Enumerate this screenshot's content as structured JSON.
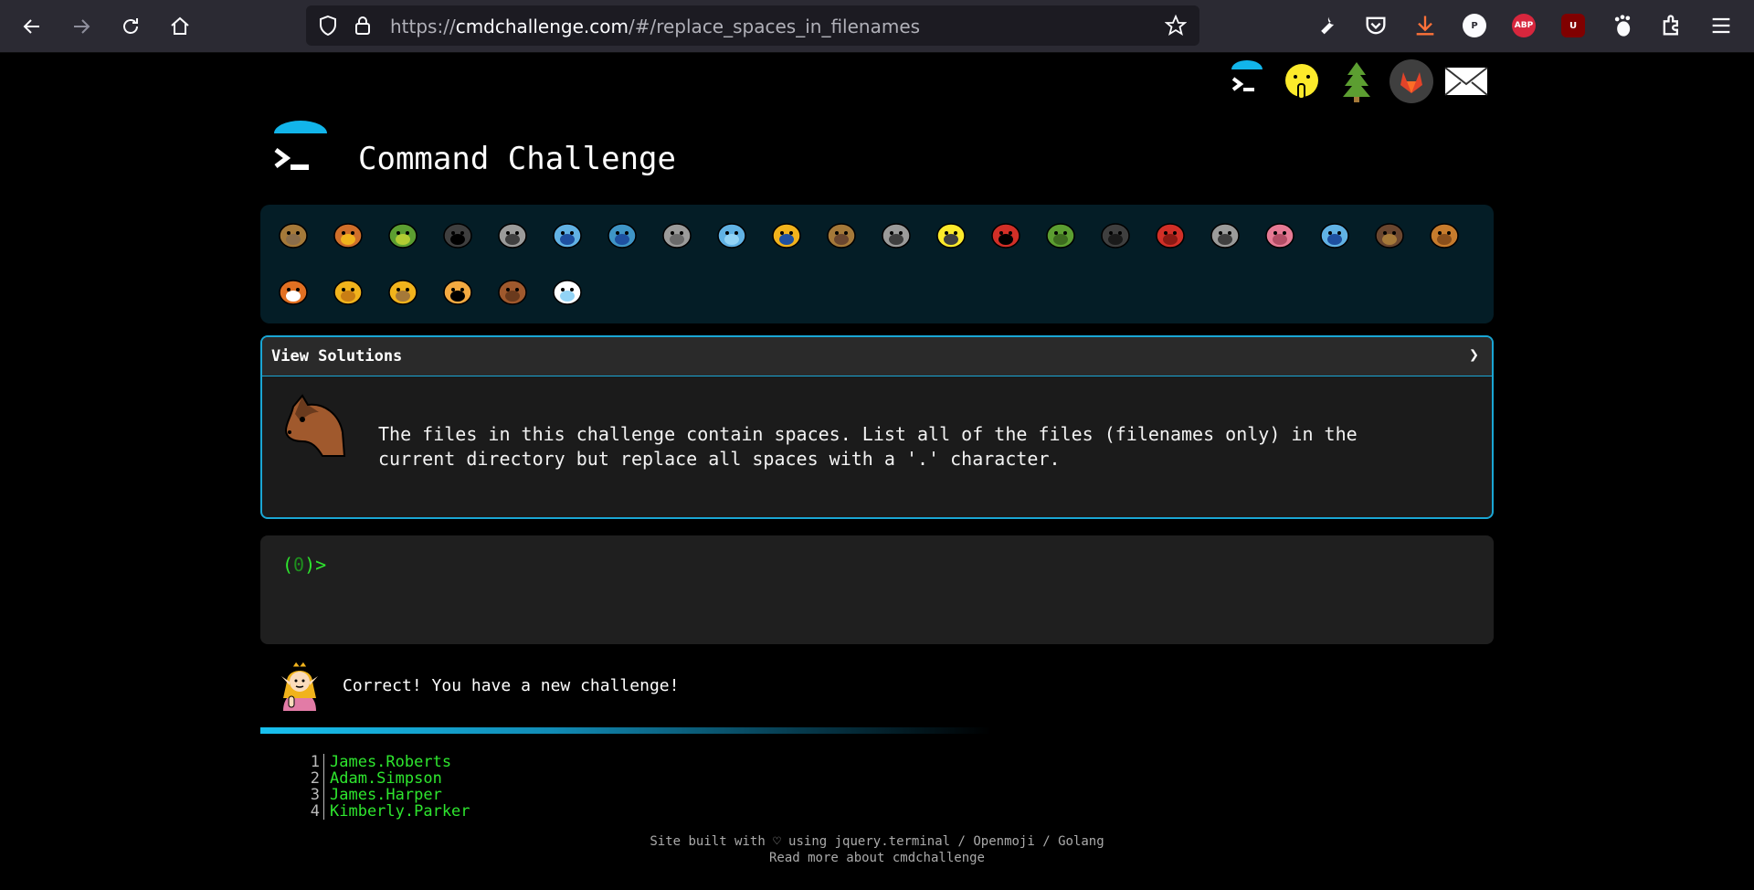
{
  "browser": {
    "url_prefix": "https://",
    "url_domain": "cmdchallenge.com",
    "url_path": "/#/replace_spaces_in_filenames",
    "extensions": [
      {
        "name": "wrench-icon"
      },
      {
        "name": "pocket-icon"
      },
      {
        "name": "download-icon"
      },
      {
        "name": "p-extension-icon",
        "label": "P"
      },
      {
        "name": "adblock-plus-icon",
        "label": "ABP"
      },
      {
        "name": "ublock-origin-icon",
        "label": "U"
      },
      {
        "name": "gnome-icon"
      },
      {
        "name": "extensions-icon"
      },
      {
        "name": "menu-icon"
      }
    ],
    "colors": {
      "chrome_bg": "#2b2a33",
      "urlbar_bg": "#1c1b22"
    }
  },
  "top_icons": [
    "terminal-logo-icon",
    "shushing-face-icon",
    "tree-icon",
    "gitlab-icon",
    "mail-icon"
  ],
  "brand": {
    "title": "Command Challenge"
  },
  "badges": [
    "snail",
    "butterfly",
    "caterpillar",
    "ant",
    "spider-web",
    "whale",
    "shark",
    "dolphin",
    "fish",
    "tropical-fish",
    "pufferfish",
    "wolf",
    "bee",
    "ladybug",
    "cricket",
    "spider",
    "scorpion",
    "fly",
    "worm",
    "microbe",
    "monkey",
    "dog",
    "fox",
    "cat",
    "lion",
    "tiger",
    "horse",
    "unicorn"
  ],
  "challenge": {
    "solutions_label": "View Solutions",
    "chevron": "❯",
    "emoji": "horse-face-icon",
    "text": "The files in this challenge contain spaces. List all of the files (filenames only) in the\ncurrent directory but replace all spaces with a '.' character."
  },
  "terminal": {
    "prompt_open": "(",
    "prompt_count": "0",
    "prompt_close": ")>"
  },
  "result": {
    "emoji": "elf-icon",
    "text": "Correct! You have a new challenge!"
  },
  "listing": [
    {
      "n": "1",
      "name": "James.Roberts"
    },
    {
      "n": "2",
      "name": "Adam.Simpson"
    },
    {
      "n": "3",
      "name": "James.Harper"
    },
    {
      "n": "4",
      "name": "Kimberly.Parker"
    }
  ],
  "footer": {
    "line1": "Site built with ♡ using jquery.terminal / Openmoji / Golang",
    "line2": "Read more about cmdchallenge"
  },
  "colors": {
    "accent": "#1aa6d4",
    "prompt_green": "#2ee62e",
    "badge_bg": "#041d26"
  }
}
